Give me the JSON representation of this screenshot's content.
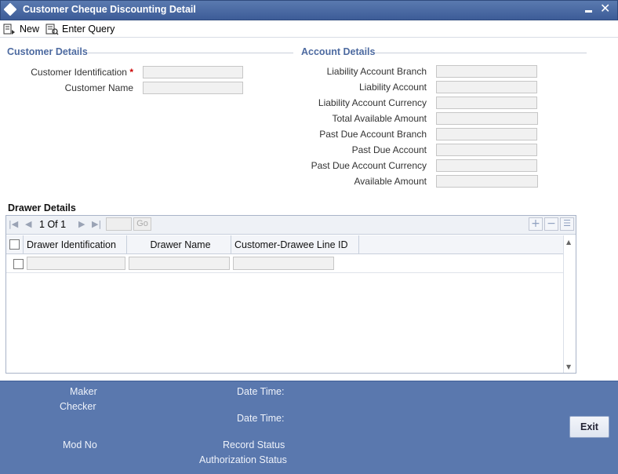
{
  "window": {
    "title": "Customer Cheque Discounting Detail"
  },
  "toolbar": {
    "new_label": "New",
    "enter_query_label": "Enter Query"
  },
  "customer_details": {
    "heading": "Customer Details",
    "customer_identification_label": "Customer Identification",
    "required_mark": "*",
    "customer_name_label": "Customer Name",
    "customer_identification_value": "",
    "customer_name_value": ""
  },
  "account_details": {
    "heading": "Account Details",
    "fields": [
      {
        "label": "Liability Account Branch",
        "value": ""
      },
      {
        "label": "Liability Account",
        "value": ""
      },
      {
        "label": "Liability Account Currency",
        "value": ""
      },
      {
        "label": "Total Available Amount",
        "value": ""
      },
      {
        "label": "Past Due Account Branch",
        "value": ""
      },
      {
        "label": "Past Due Account",
        "value": ""
      },
      {
        "label": "Past Due Account Currency",
        "value": ""
      },
      {
        "label": "Available Amount",
        "value": ""
      }
    ]
  },
  "drawer_details": {
    "heading": "Drawer Details",
    "pager": {
      "current_page": "1",
      "of_label": "Of",
      "total_pages": "1",
      "go_label": "Go",
      "page_input": ""
    },
    "columns": [
      "Drawer Identification",
      "Drawer Name",
      "Customer-Drawee Line ID"
    ],
    "rows": [
      {
        "drawer_identification": "",
        "drawer_name": "",
        "line_id": ""
      }
    ]
  },
  "footer": {
    "maker_label": "Maker",
    "checker_label": "Checker",
    "date_time_label_1": "Date Time:",
    "date_time_label_2": "Date Time:",
    "mod_no_label": "Mod No",
    "record_status_label": "Record Status",
    "authorization_status_label": "Authorization Status",
    "exit_label": "Exit"
  },
  "colors": {
    "title_bar": "#4a6aa5",
    "footer": "#5a78ae",
    "section_heading": "#4d6aa0",
    "required": "#cc0000"
  }
}
